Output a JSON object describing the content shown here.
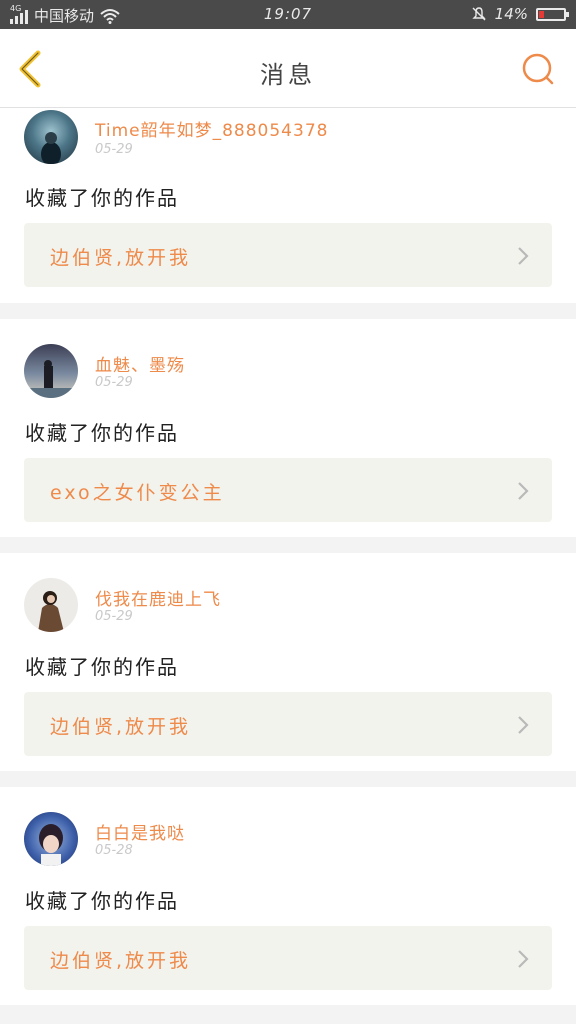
{
  "status_bar": {
    "network": "4G",
    "carrier": "中国移动",
    "time": "19:07",
    "battery_percent": "14%",
    "battery_color": "#e53935"
  },
  "header": {
    "title": "消息",
    "back_icon": "chevron-left-icon",
    "search_icon": "search-icon"
  },
  "notifications": [
    {
      "username": "Time韶年如梦_888054378",
      "date": "05-29",
      "action": "收藏了你的作品",
      "work_title": "边伯贤,放开我"
    },
    {
      "username": "血魅、墨殇",
      "date": "05-29",
      "action": "收藏了你的作品",
      "work_title": "exo之女仆变公主"
    },
    {
      "username": "伐我在鹿迪上飞",
      "date": "05-29",
      "action": "收藏了你的作品",
      "work_title": "边伯贤,放开我"
    },
    {
      "username": "白白是我哒",
      "date": "05-28",
      "action": "收藏了你的作品",
      "work_title": "边伯贤,放开我"
    }
  ],
  "colors": {
    "accent": "#ee8a4a",
    "back_icon": "#f2c230",
    "card_bg": "#f3f3ee"
  }
}
